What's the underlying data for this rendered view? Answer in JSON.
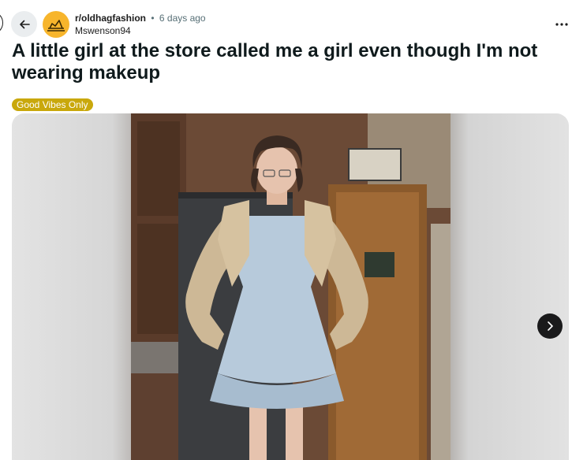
{
  "post": {
    "subreddit": "r/oldhagfashion",
    "separator": "•",
    "time_ago": "6 days ago",
    "author": "Mswenson94",
    "title": "A little girl at the store called me a girl even though I'm not wearing makeup",
    "flair": "Good Vibes Only"
  },
  "icons": {
    "back": "arrow-left-icon",
    "avatar": "subreddit-avatar-icon",
    "more": "ellipsis-icon",
    "next": "chevron-right-icon"
  },
  "colors": {
    "flair_bg": "#c9a80c",
    "avatar_bg": "#f7b52c",
    "back_bg": "#eaedef",
    "next_bg": "#1a1a1b"
  }
}
